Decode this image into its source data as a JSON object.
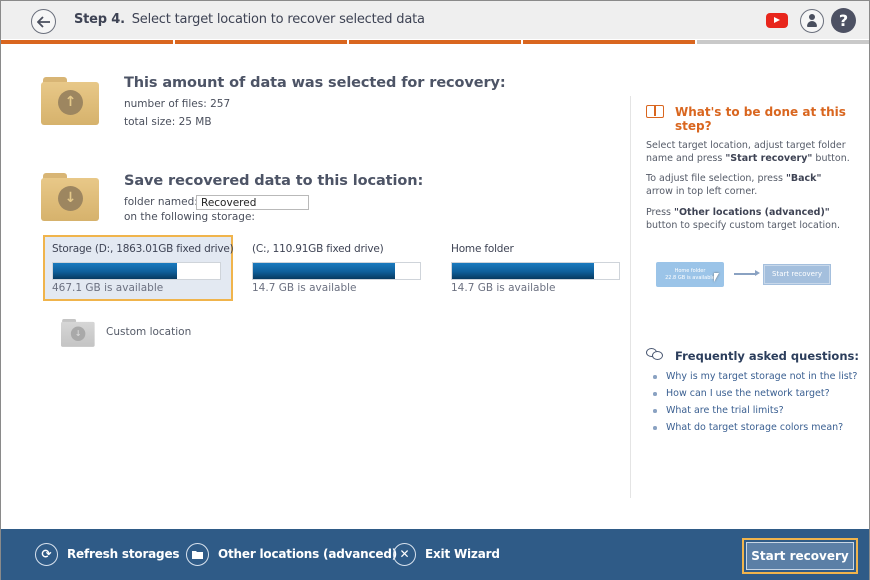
{
  "header": {
    "step_label": "Step 4.",
    "title": "Select target location to recover selected data",
    "icons": [
      "back-arrow-icon",
      "youtube-icon",
      "user-icon",
      "help-icon"
    ],
    "help_glyph": "?"
  },
  "progress": {
    "steps_total": 5,
    "steps_completed": 4,
    "active_color": "#d9661f",
    "inactive_color": "#c9c9c9"
  },
  "selected_data": {
    "title": "This amount of data was selected for recovery:",
    "files_label": "number of files: 257",
    "size_label": "total size: 25 MB",
    "icon_glyph": "↑"
  },
  "save_location": {
    "title": "Save recovered data to this location:",
    "folder_label": "folder named:",
    "folder_value": "Recovered",
    "storage_label": "on the following storage:",
    "icon_glyph": "↓"
  },
  "storages": [
    {
      "name": "Storage (D:, 1863.01GB fixed drive)",
      "available": "467.1 GB is available",
      "used_fraction": 0.74,
      "selected": true
    },
    {
      "name": "(C:, 110.91GB fixed drive)",
      "available": "14.7 GB is available",
      "used_fraction": 0.85,
      "selected": false
    },
    {
      "name": "Home folder",
      "available": "14.7 GB is available",
      "used_fraction": 0.85,
      "selected": false
    }
  ],
  "custom_location": {
    "label": "Custom location",
    "icon_glyph": "↓"
  },
  "help_panel": {
    "title": "What's to be done at this step?",
    "p1_pre": "Select target location, adjust target folder name and press ",
    "p1_bold": "\"Start recovery\"",
    "p1_post": " button.",
    "p2_pre": "To adjust file selection, press ",
    "p2_bold": "\"Back\"",
    "p2_post": " arrow in top left corner.",
    "p3_pre": "Press ",
    "p3_bold": "\"Other locations (advanced)\"",
    "p3_post": " button to specify custom target location.",
    "illustration": {
      "tile_name": "Home folder",
      "tile_avail": "22.8 GB is available",
      "button": "Start recovery"
    }
  },
  "faq": {
    "title": "Frequently asked questions:",
    "items": [
      "Why is my target storage not in the list?",
      "How can I use the network target?",
      "What are the trial limits?",
      "What do target storage colors mean?"
    ]
  },
  "footer": {
    "refresh": "Refresh storages",
    "other_locations": "Other locations (advanced)",
    "exit": "Exit Wizard",
    "start": "Start recovery",
    "refresh_glyph": "⟳",
    "exit_glyph": "✕"
  }
}
